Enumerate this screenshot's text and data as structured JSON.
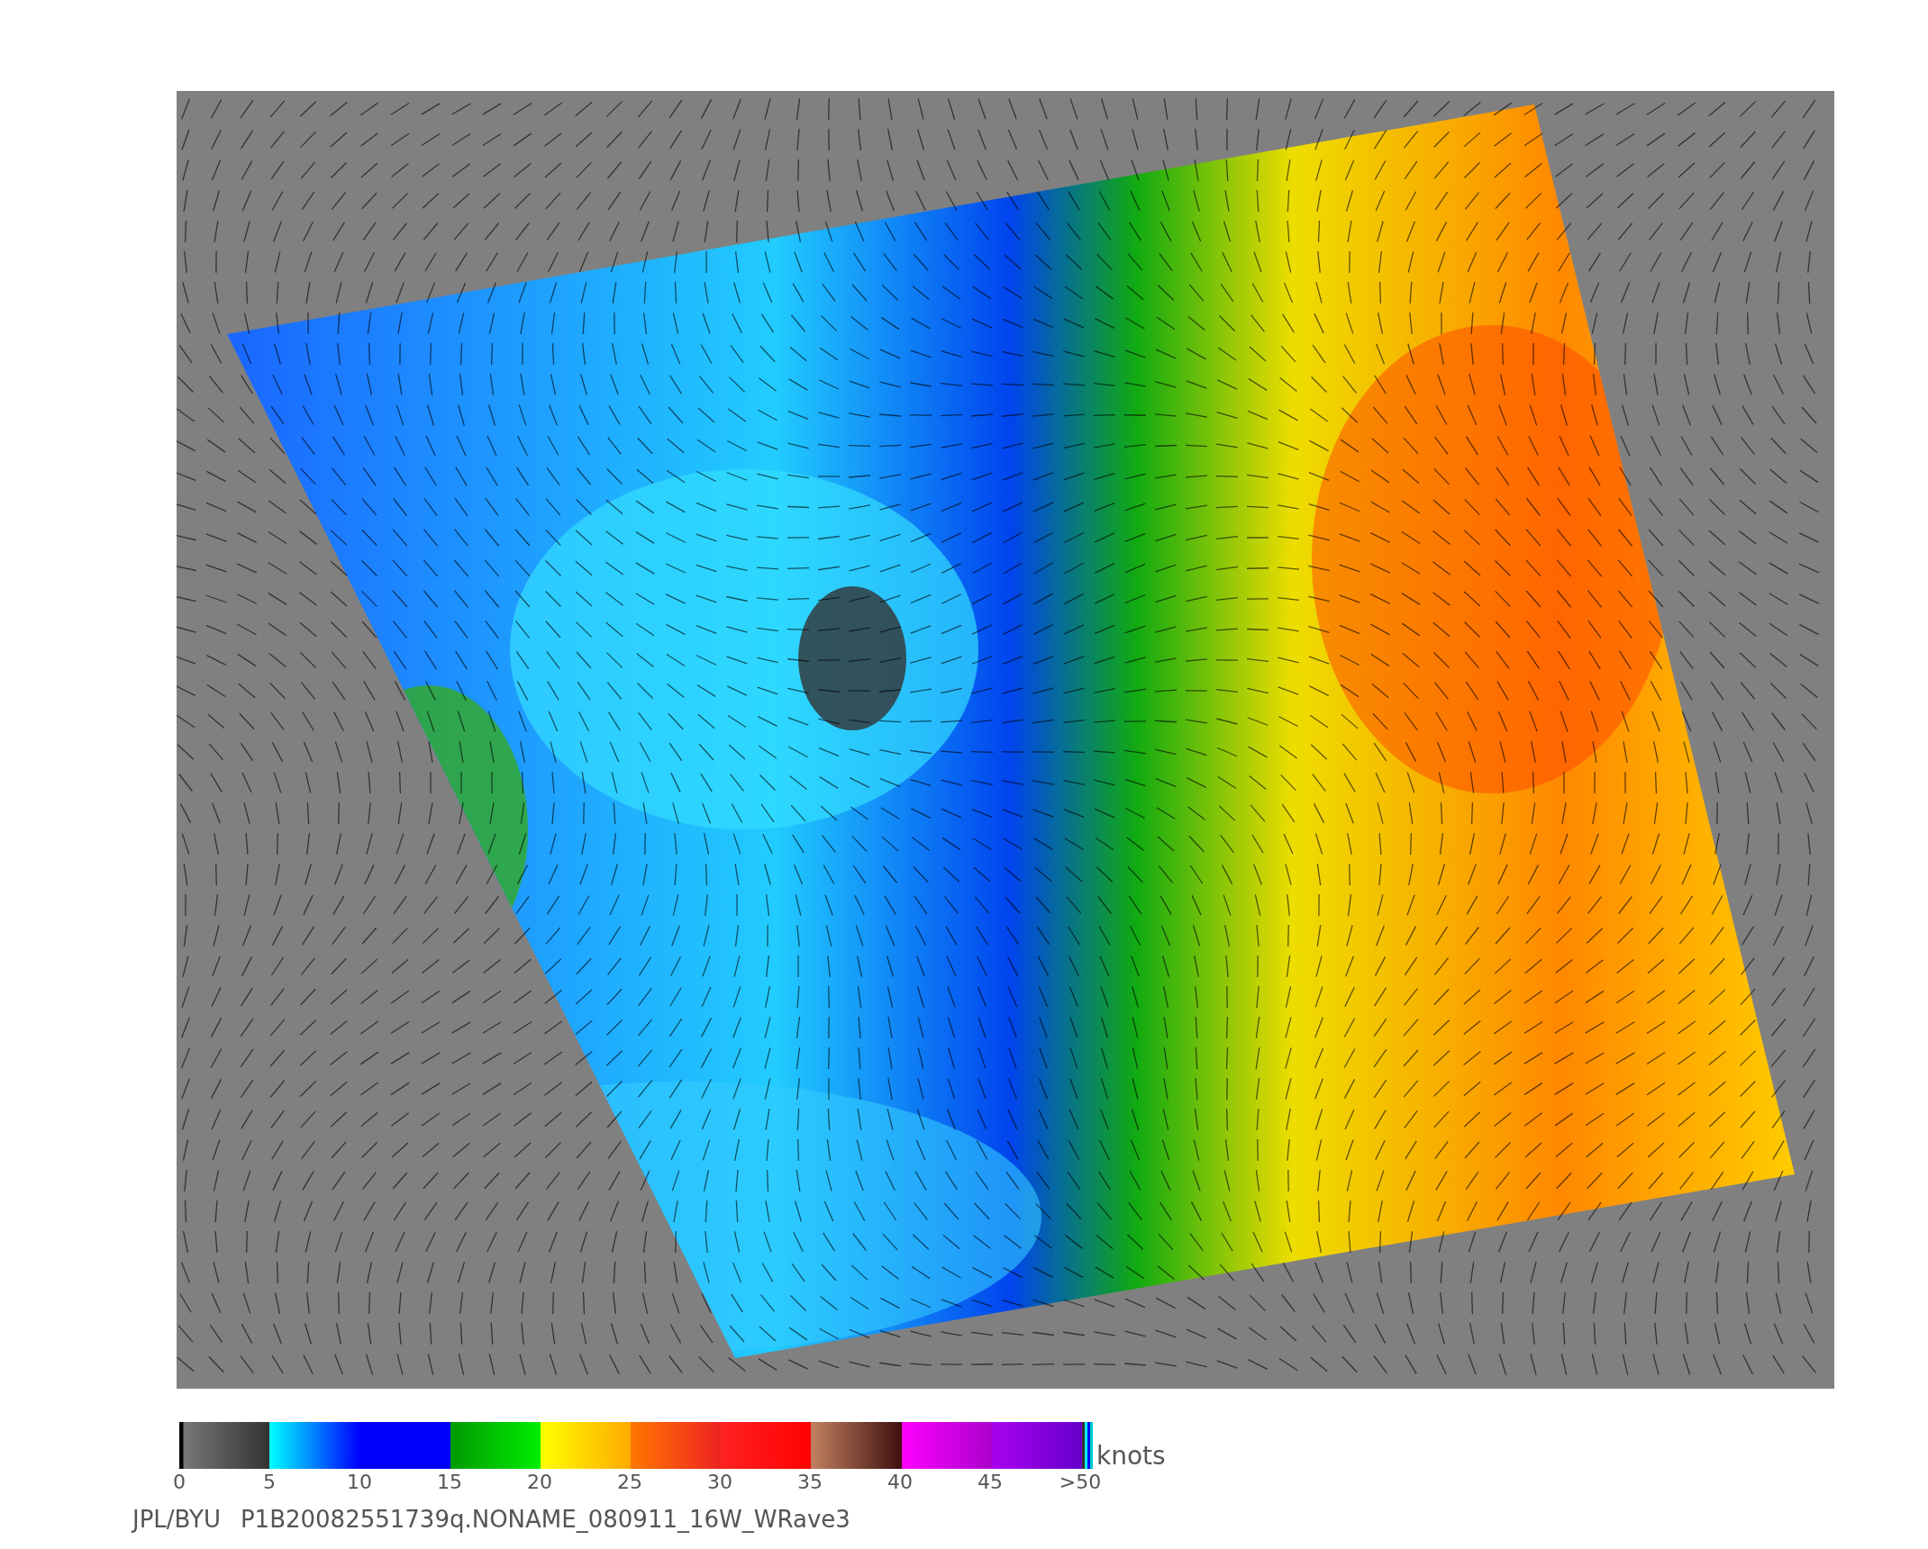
{
  "colorbar": {
    "ticks": [
      "0",
      "5",
      "10",
      "15",
      "20",
      "25",
      "30",
      "35",
      "40",
      "45",
      ">50"
    ],
    "unit": "knots"
  },
  "caption": {
    "source": "JPL/BYU",
    "file": "P1B20082551739q.NONAME_080911_16W_WRave3"
  }
}
